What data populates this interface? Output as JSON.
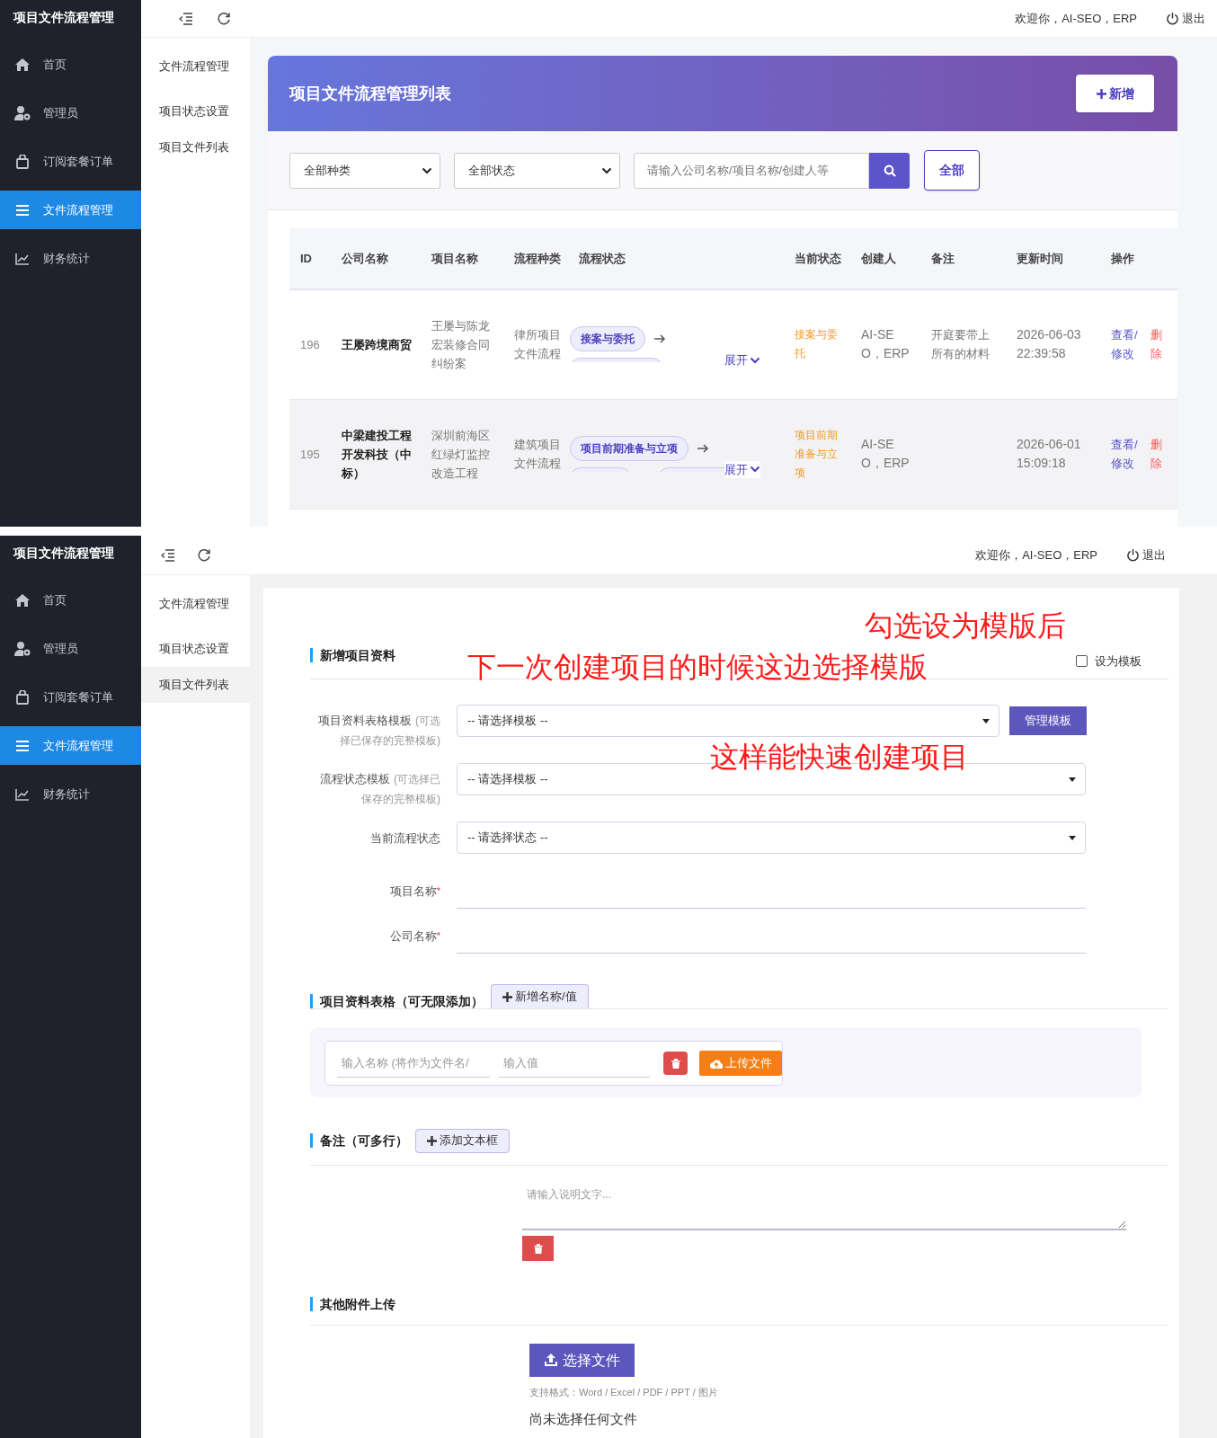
{
  "screens": [
    {
      "kind": "list",
      "sidebar": {
        "title": "项目文件流程管理",
        "items": [
          {
            "label": "首页",
            "selected": false
          },
          {
            "label": "管理员",
            "selected": false
          },
          {
            "label": "订阅套餐订单",
            "selected": false
          },
          {
            "label": "文件流程管理",
            "selected": true
          },
          {
            "label": "财务统计",
            "selected": false
          }
        ]
      },
      "header": {
        "welcome": "欢迎你，AI-SEO，ERP",
        "logout": "退出"
      },
      "subnav": [
        {
          "label": "文件流程管理",
          "selected": false
        },
        {
          "label": "项目状态设置",
          "selected": false
        },
        {
          "label": "项目文件列表",
          "selected": false
        }
      ],
      "panel": {
        "title": "项目文件流程管理列表",
        "add_button": "新增",
        "filters": {
          "type_select": "全部种类",
          "status_select": "全部状态",
          "search_placeholder": "请输入公司名称/项目名称/创建人等",
          "all_button": "全部"
        },
        "table": {
          "columns": [
            "ID",
            "公司名称",
            "项目名称",
            "流程种类",
            "流程状态",
            "当前状态",
            "创建人",
            "备注",
            "更新时间",
            "操作"
          ],
          "rows": [
            {
              "id": "196",
              "company": "王屡跨境商贸",
              "project": "王屡与陈龙宏装修合同纠纷案",
              "flow_type": "律所项目文件流程",
              "flow_tags": [
                "接案与委托"
              ],
              "clipped_tags": [
                {
                  "kind": "wide"
                }
              ],
              "expand_link": "展开",
              "current_status": "接案与委托",
              "creator": "AI-SEO，ERP",
              "note": "开庭要带上所有的材料",
              "updated": "2026-06-03 22:39:58",
              "view_link": "查看/修改",
              "delete_link": "删除",
              "hovered": false
            },
            {
              "id": "195",
              "company": "中梁建投工程开发科技（中标）",
              "project": "深圳前海区红绿灯监控改造工程",
              "flow_type": "建筑项目文件流程",
              "flow_tags": [
                "项目前期准备与立项"
              ],
              "clipped_tags": [
                {
                  "kind": "narrow"
                },
                {
                  "kind": "wide"
                }
              ],
              "expand_link": "展开",
              "current_status": "项目前期准备与立项",
              "creator": "AI-SEO，ERP",
              "updated": "2026-06-01 15:09:18",
              "view_link": "查看/修改",
              "delete_link": "删除",
              "hovered": true
            }
          ]
        }
      }
    },
    {
      "kind": "form",
      "sidebar": {
        "title": "项目文件流程管理",
        "items": [
          {
            "label": "首页",
            "selected": false
          },
          {
            "label": "管理员",
            "selected": false
          },
          {
            "label": "订阅套餐订单",
            "selected": false
          },
          {
            "label": "文件流程管理",
            "selected": true
          },
          {
            "label": "财务统计",
            "selected": false
          }
        ]
      },
      "header": {
        "welcome": "欢迎你，AI-SEO，ERP",
        "logout": "退出"
      },
      "subnav": [
        {
          "label": "文件流程管理",
          "selected": false
        },
        {
          "label": "项目状态设置",
          "selected": false
        },
        {
          "label": "项目文件列表",
          "selected": true
        }
      ],
      "form": {
        "info_section": {
          "title": "新增项目资料",
          "template_checkbox": {
            "label": "设为模板",
            "checked": false
          },
          "fields": [
            {
              "kind": "select",
              "label": "项目资料表格模板",
              "hint": "(可选择已保存的完整模板)",
              "value": "-- 请选择模板 --",
              "button": "管理模板"
            },
            {
              "kind": "select",
              "label": "流程状态模板",
              "hint": "(可选择已保存的完整模板)",
              "value": "-- 请选择模板 --"
            },
            {
              "kind": "select",
              "label": "当前流程状态",
              "value": "-- 请选择状态 --"
            },
            {
              "kind": "text",
              "label": "项目名称",
              "required_mark": "*"
            },
            {
              "kind": "text",
              "label": "公司名称",
              "required_mark": "*"
            }
          ]
        },
        "table_section": {
          "title": "项目资料表格（可无限添加）",
          "add_button": "新增名称/值",
          "rows": [
            {
              "name_placeholder": "输入名称 (将作为文件名/",
              "value_placeholder": "输入值",
              "upload_button": "上传文件"
            }
          ]
        },
        "notes_section": {
          "title": "备注（可多行）",
          "add_button": "添加文本框",
          "notes": [
            {
              "placeholder": "请输入说明文字..."
            }
          ]
        },
        "attachments_section": {
          "title": "其他附件上传",
          "choose_button": "选择文件",
          "formats_hint": "支持格式：Word / Excel / PDF / PPT / 图片",
          "file_status": "尚未选择任何文件"
        }
      },
      "annotations": [
        {
          "text": "勾选设为模版后"
        },
        {
          "text": "下一次创建项目的时候这边选择模版"
        },
        {
          "text": "这样能快速创建项目"
        }
      ]
    }
  ]
}
